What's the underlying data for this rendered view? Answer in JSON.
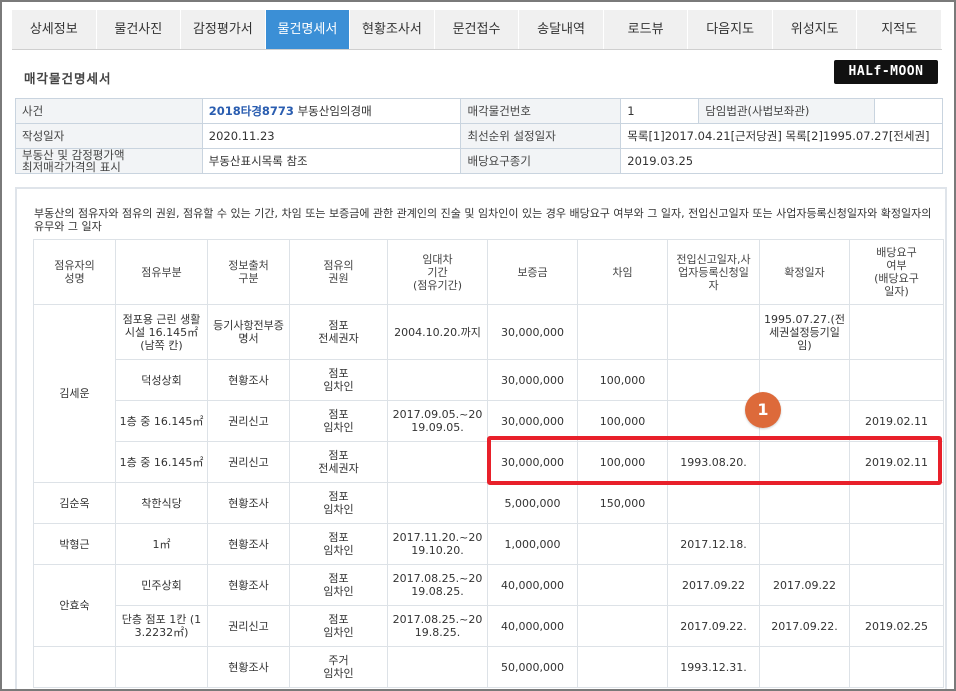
{
  "tabs": [
    "상세정보",
    "물건사진",
    "감정평가서",
    "물건명세서",
    "현황조사서",
    "문건접수",
    "송달내역",
    "로드뷰",
    "다음지도",
    "위성지도",
    "지적도"
  ],
  "active_tab": 3,
  "doc_title": "매각물건명세서",
  "logo": "HALf-MOON",
  "info": {
    "case_label": "사건",
    "case_no": "2018타경8773",
    "case_type": "부동산임의경매",
    "item_no_label": "매각물건번호",
    "item_no": "1",
    "judge_label": "담임법관(사법보좌관)",
    "judge_value": "",
    "date_label": "작성일자",
    "date": "2020.11.23",
    "priority_label": "최선순위 설정일자",
    "priority": "목록[1]2017.04.21[근저당권] 목록[2]1995.07.27[전세권]",
    "price_label_1": "부동산 및 감정평가액",
    "price_label_2": "최저매각가격의 표시",
    "price_value": "부동산표시목록 참조",
    "deadline_label": "배당요구종기",
    "deadline": "2019.03.25"
  },
  "occupancy_note": "부동산의 점유자와 점유의 권원, 점유할 수 있는 기간, 차임 또는 보증금에 관한 관계인의 진술 및 임차인이 있는 경우 배당요구 여부와 그 일자, 전입신고일자 또는 사업자등록신청일자와 확정일자의 유무와 그 일자",
  "headers": [
    "점유자의\n성명",
    "점유부분",
    "정보출처\n구분",
    "점유의\n권원",
    "임대차\n기간\n(점유기간)",
    "보증금",
    "차임",
    "전입신고일자,사\n업자등록신청일\n자",
    "확정일자",
    "배당요구\n여부\n(배당요구\n일자)"
  ],
  "groups": [
    {
      "name": "김세운",
      "rows": [
        [
          "점포용 근린 생활시설 16.145㎡(남쪽 칸)",
          "등기사항전부증명서",
          "점포\n전세권자",
          "2004.10.20.까지",
          "30,000,000",
          "",
          "",
          "1995.07.27.(전세권설정등기일임)",
          ""
        ],
        [
          "덕성상회",
          "현황조사",
          "점포\n임차인",
          "",
          "30,000,000",
          "100,000",
          "",
          "",
          ""
        ],
        [
          "1층 중 16.145㎡",
          "권리신고",
          "점포\n임차인",
          "2017.09.05.~2019.09.05.",
          "30,000,000",
          "100,000",
          "",
          "",
          "2019.02.11"
        ],
        [
          "1층 중 16.145㎡",
          "권리신고",
          "점포\n전세권자",
          "",
          "30,000,000",
          "100,000",
          "1993.08.20.",
          "",
          "2019.02.11"
        ]
      ]
    },
    {
      "name": "김순옥",
      "rows": [
        [
          "착한식당",
          "현황조사",
          "점포\n임차인",
          "",
          "5,000,000",
          "150,000",
          "",
          "",
          ""
        ]
      ]
    },
    {
      "name": "박형근",
      "rows": [
        [
          "1㎡",
          "현황조사",
          "점포\n임차인",
          "2017.11.20.~2019.10.20.",
          "1,000,000",
          "",
          "2017.12.18.",
          "",
          ""
        ]
      ]
    },
    {
      "name": "안효숙",
      "rows": [
        [
          "민주상회",
          "현황조사",
          "점포\n임차인",
          "2017.08.25.~2019.08.25.",
          "40,000,000",
          "",
          "2017.09.22",
          "2017.09.22",
          ""
        ],
        [
          "단층 점포 1칸 (13.2232㎡)",
          "권리신고",
          "점포\n임차인",
          "2017.08.25.~2019.8.25.",
          "40,000,000",
          "",
          "2017.09.22.",
          "2017.09.22.",
          "2019.02.25"
        ]
      ]
    },
    {
      "name": "",
      "rows": [
        [
          "",
          "현황조사",
          "주거\n임차인",
          "",
          "50,000,000",
          "",
          "1993.12.31.",
          "",
          ""
        ]
      ]
    }
  ],
  "marker_label": "1"
}
